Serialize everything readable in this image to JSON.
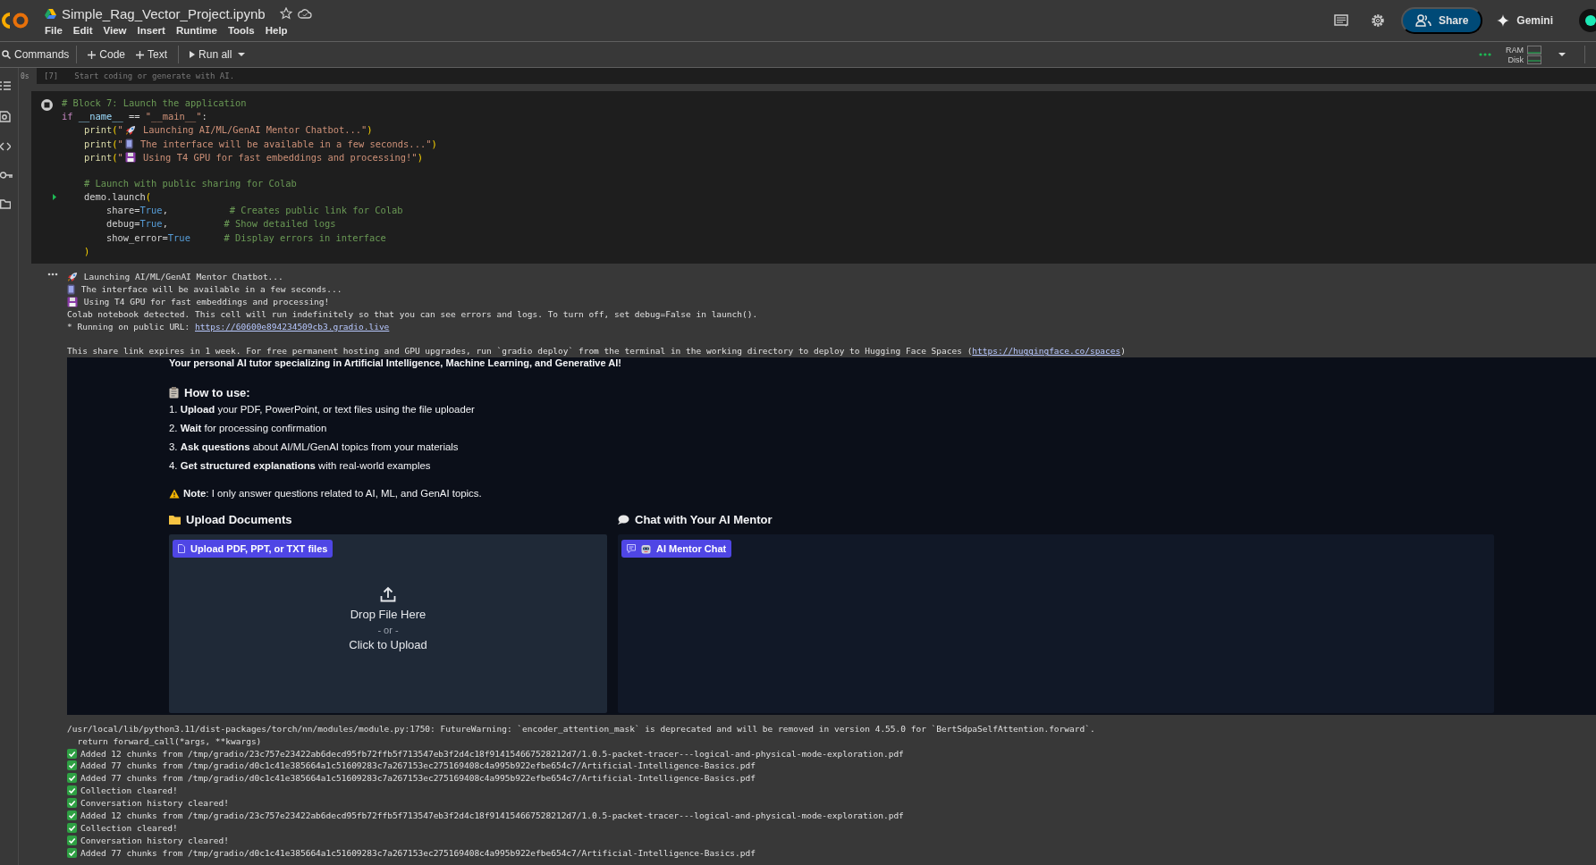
{
  "header": {
    "title": "Simple_Rag_Vector_Project.ipynb",
    "menu": [
      "File",
      "Edit",
      "View",
      "Insert",
      "Runtime",
      "Tools",
      "Help"
    ],
    "share_label": "Share",
    "gemini_label": "Gemini"
  },
  "toolbar": {
    "commands": "Commands",
    "add_code": "Code",
    "add_text": "Text",
    "run_all": "Run all",
    "ram_label": "RAM",
    "disk_label": "Disk"
  },
  "previous_cell": {
    "count": "[7]",
    "time": "0s",
    "placeholder": "Start coding or generate with AI."
  },
  "code_cell": {
    "lines": [
      {
        "kind": "code",
        "tokens": [
          {
            "kind": "comment",
            "text": "# Block 7: Launch the application"
          }
        ]
      },
      {
        "kind": "code",
        "tokens": [
          {
            "kind": "keyword",
            "text": "if"
          },
          {
            "kind": "variable",
            "text": " __name__"
          },
          {
            "kind": "plain",
            "text": " =="
          },
          {
            "kind": "string",
            "text": " \"__main__\""
          },
          {
            "kind": "plain",
            "text": ":"
          }
        ]
      },
      {
        "kind": "code",
        "tokens": [
          {
            "kind": "function",
            "text": "    print"
          },
          {
            "kind": "bracket",
            "text": "("
          },
          {
            "kind": "string",
            "text": "\""
          },
          {
            "kind": "emoji"
          },
          {
            "kind": "string",
            "text": " Launching AI/ML/GenAI Mentor Chatbot...\""
          },
          {
            "kind": "bracket",
            "text": ")"
          }
        ]
      },
      {
        "kind": "code",
        "tokens": [
          {
            "kind": "function",
            "text": "    print"
          },
          {
            "kind": "bracket",
            "text": "("
          },
          {
            "kind": "string",
            "text": "\""
          },
          {
            "kind": "emoji"
          },
          {
            "kind": "string",
            "text": " The interface will be available in a few seconds...\""
          },
          {
            "kind": "bracket",
            "text": ")"
          }
        ]
      },
      {
        "kind": "code",
        "tokens": [
          {
            "kind": "function",
            "text": "    print"
          },
          {
            "kind": "bracket",
            "text": "("
          },
          {
            "kind": "string",
            "text": "\""
          },
          {
            "kind": "emoji"
          },
          {
            "kind": "string",
            "text": " Using T4 GPU for fast embeddings and processing!\""
          },
          {
            "kind": "bracket",
            "text": ")"
          }
        ]
      },
      {
        "kind": "blank"
      },
      {
        "kind": "code",
        "tokens": [
          {
            "kind": "comment",
            "text": "    # Launch with public sharing for Colab"
          }
        ]
      },
      {
        "kind": "code",
        "marker": true,
        "tokens": [
          {
            "kind": "plain",
            "text": "    demo.launch"
          },
          {
            "kind": "bracket",
            "text": "("
          }
        ]
      },
      {
        "kind": "code",
        "tokens": [
          {
            "kind": "plain",
            "text": "        share="
          },
          {
            "kind": "boolean",
            "text": "True"
          },
          {
            "kind": "plain",
            "text": ","
          },
          {
            "kind": "comment",
            "text": "           # Creates public link for Colab"
          }
        ]
      },
      {
        "kind": "code",
        "tokens": [
          {
            "kind": "plain",
            "text": "        debug="
          },
          {
            "kind": "boolean",
            "text": "True"
          },
          {
            "kind": "plain",
            "text": ","
          },
          {
            "kind": "comment",
            "text": "          # Show detailed logs"
          }
        ]
      },
      {
        "kind": "code",
        "tokens": [
          {
            "kind": "plain",
            "text": "        show_error="
          },
          {
            "kind": "boolean",
            "text": "True"
          },
          {
            "kind": "comment",
            "text": "      # Display errors in interface"
          }
        ]
      },
      {
        "kind": "code",
        "tokens": [
          {
            "kind": "bracket",
            "text": "    )"
          }
        ]
      }
    ]
  },
  "output": {
    "lines": [
      {
        "kind": "text",
        "tokens": [
          {
            "kind": "emoji"
          },
          {
            "kind": "plain",
            "text": " Launching AI/ML/GenAI Mentor Chatbot..."
          }
        ]
      },
      {
        "kind": "text",
        "tokens": [
          {
            "kind": "emoji"
          },
          {
            "kind": "plain",
            "text": " The interface will be available in a few seconds..."
          }
        ]
      },
      {
        "kind": "text",
        "tokens": [
          {
            "kind": "emoji"
          },
          {
            "kind": "plain",
            "text": " Using T4 GPU for fast embeddings and processing!"
          }
        ]
      },
      {
        "kind": "text",
        "tokens": [
          {
            "kind": "plain",
            "text": "Colab notebook detected. This cell will run indefinitely so that you can see errors and logs. To turn off, set debug=False in launch()."
          }
        ]
      },
      {
        "kind": "text",
        "tokens": [
          {
            "kind": "plain",
            "text": "* Running on public URL: "
          },
          {
            "kind": "link",
            "text": "https://60600e894234509cb3.gradio.live"
          }
        ]
      },
      {
        "kind": "blank"
      },
      {
        "kind": "text",
        "tokens": [
          {
            "kind": "plain",
            "text": "This share link expires in 1 week. For free permanent hosting and GPU upgrades, run `gradio deploy` from the terminal in the working directory to deploy to Hugging Face Spaces ("
          },
          {
            "kind": "link",
            "text": "https://huggingface.co/spaces"
          },
          {
            "kind": "plain",
            "text": ")"
          }
        ]
      }
    ]
  },
  "app": {
    "subtitle": "Your personal AI tutor specializing in Artificial Intelligence, Machine Learning, and Generative AI!",
    "how_to_heading": "How to use:",
    "steps": [
      "1. **Upload** your PDF, PowerPoint, or text files using the file uploader",
      "2. **Wait** for processing confirmation",
      "3. **Ask questions** about AI/ML/GenAI topics from your materials",
      "4. **Get structured explanations** with real-world examples"
    ],
    "note": "**Note**: I only answer questions related to AI, ML, and GenAI topics.",
    "upload_heading": "Upload Documents",
    "upload_label": "Upload PDF, PPT, or TXT files",
    "drop_text": "Drop File Here",
    "or_text": "- or -",
    "click_text": "Click to Upload",
    "chat_heading": "Chat with Your AI Mentor",
    "chat_label": "AI Mentor Chat"
  },
  "logs": [
    {
      "kind": "plain",
      "text": "/usr/local/lib/python3.11/dist-packages/torch/nn/modules/module.py:1750: FutureWarning: `encoder_attention_mask` is deprecated and will be removed in version 4.55.0 for `BertSdpaSelfAttention.forward`."
    },
    {
      "kind": "plain",
      "text": "  return forward_call(*args, **kwargs)"
    },
    {
      "kind": "check",
      "text": "Added 12 chunks from /tmp/gradio/23c757e23422ab6decd95fb72ffb5f713547eb3f2d4c18f914154667528212d7/1.0.5-packet-tracer---logical-and-physical-mode-exploration.pdf"
    },
    {
      "kind": "check",
      "text": "Added 77 chunks from /tmp/gradio/d0c1c41e385664a1c51609283c7a267153ec275169408c4a995b922efbe654c7/Artificial-Intelligence-Basics.pdf"
    },
    {
      "kind": "check",
      "text": "Added 77 chunks from /tmp/gradio/d0c1c41e385664a1c51609283c7a267153ec275169408c4a995b922efbe654c7/Artificial-Intelligence-Basics.pdf"
    },
    {
      "kind": "check",
      "text": "Collection cleared!"
    },
    {
      "kind": "check",
      "text": "Conversation history cleared!"
    },
    {
      "kind": "check",
      "text": "Added 12 chunks from /tmp/gradio/23c757e23422ab6decd95fb72ffb5f713547eb3f2d4c18f914154667528212d7/1.0.5-packet-tracer---logical-and-physical-mode-exploration.pdf"
    },
    {
      "kind": "check",
      "text": "Collection cleared!"
    },
    {
      "kind": "check",
      "text": "Conversation history cleared!"
    },
    {
      "kind": "check",
      "text": "Added 77 chunks from /tmp/gradio/d0c1c41e385664a1c51609283c7a267153ec275169408c4a995b922efbe654c7/Artificial-Intelligence-Basics.pdf"
    }
  ]
}
